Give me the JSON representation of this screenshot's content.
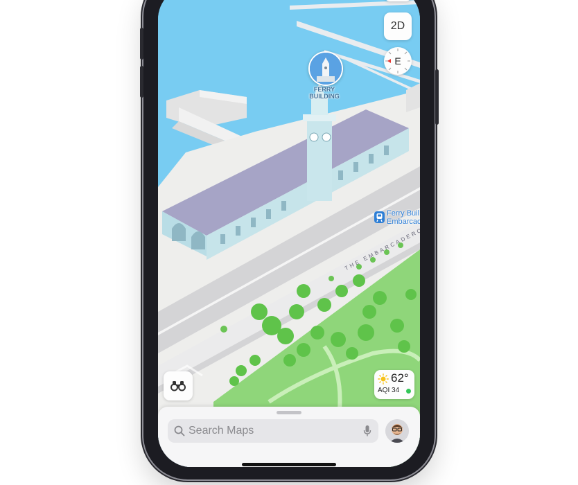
{
  "map_controls": {
    "view_mode_label": "2D",
    "compass_heading": "E"
  },
  "landmark": {
    "name_line1": "FERRY",
    "name_line2": "BUILDING"
  },
  "transit": {
    "line1": "Ferry Buil",
    "line2": "Embarcad"
  },
  "street": {
    "name": "THE EMBARCADERO"
  },
  "weather": {
    "temperature": "62°",
    "aqi_label": "AQI 34"
  },
  "search": {
    "placeholder": "Search Maps"
  },
  "colors": {
    "water": "#78ccf2",
    "accent": "#2e7fd6",
    "park": "#8fd67a",
    "aqi_good": "#34c759"
  },
  "icons": [
    "binoculars-icon",
    "sun-icon",
    "search-icon",
    "microphone-icon",
    "memoji-avatar-icon",
    "compass-arrow-icon",
    "train-icon",
    "ferry-building-icon"
  ]
}
